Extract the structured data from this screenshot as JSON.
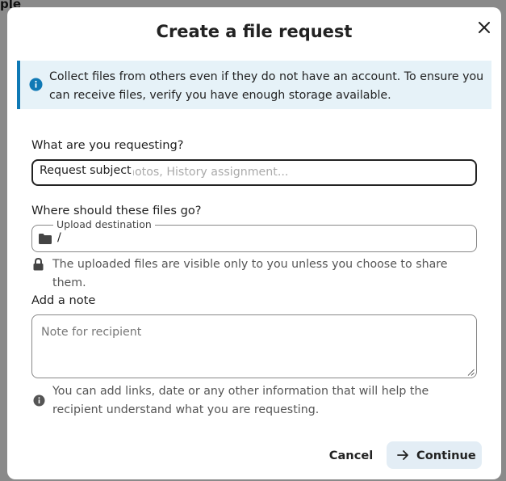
{
  "background": {
    "partial_text": "ple"
  },
  "dialog": {
    "title": "Create a file request",
    "close_icon": "close-icon",
    "info_banner": {
      "icon": "info-icon",
      "text": "Collect files from others even if they do not have an account. To ensure you can receive files, verify you have enough storage available."
    },
    "subject": {
      "label": "What are you requesting?",
      "floating_label": "Request subject",
      "placeholder_visible": "hotos, History assignment..."
    },
    "destination": {
      "label": "Where should these files go?",
      "legend": "Upload destination",
      "value": "/",
      "folder_icon": "folder-icon",
      "hint": "The uploaded files are visible only to you unless you choose to share them.",
      "hint_icon": "lock-icon"
    },
    "note": {
      "label": "Add a note",
      "placeholder": "Note for recipient",
      "hint": "You can add links, date or any other information that will help the recipient understand what you are requesting.",
      "hint_icon": "info-icon"
    },
    "footer": {
      "cancel_label": "Cancel",
      "continue_label": "Continue",
      "continue_icon": "arrow-right-icon"
    }
  },
  "colors": {
    "accent": "#0f79b5",
    "banner_bg": "#e6f2f8",
    "continue_bg": "#e3edf5",
    "backdrop": "#8a8a8a"
  }
}
